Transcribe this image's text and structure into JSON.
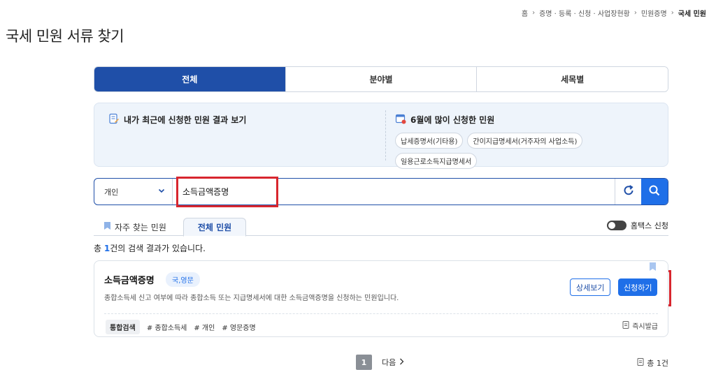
{
  "breadcrumb": {
    "items": [
      "홈",
      "증명 · 등록 · 신청 · 사업장현황",
      "민원증명"
    ],
    "current": "국세 민원",
    "separator": "›"
  },
  "page_title": "국세 민원 서류 찾기",
  "tabs": [
    {
      "label": "전체",
      "active": true
    },
    {
      "label": "분야별",
      "active": false
    },
    {
      "label": "세목별",
      "active": false
    }
  ],
  "info": {
    "recent_label": "내가 최근에 신청한 민원 결과 보기",
    "popular_title": "6월에 많이 신청한 민원",
    "popular_items": [
      "납세증명서(기타용)",
      "간이지급명세서(거주자의 사업소득)",
      "일용근로소득지급명세서"
    ]
  },
  "search": {
    "type_selected": "개인",
    "query": "소득금액증명"
  },
  "subtabs": {
    "favorites_label": "자주 찾는 민원",
    "all_label": "전체 민원",
    "hometax_toggle_label": "홈택스 신청"
  },
  "results": {
    "prefix": "총 ",
    "count": "1",
    "suffix": "건의 검색 결과가 있습니다."
  },
  "card": {
    "title": "소득금액증명",
    "badge": "국,영문",
    "description": "종합소득세 신고 여부에 따라 종합소득 또는 지급명세서에 대한 소득금액증명을 신청하는 민원입니다.",
    "main_tag": "통합검색",
    "tags": [
      "# 종합소득세",
      "# 개인",
      "# 영문증명"
    ],
    "instant_label": "즉시발급",
    "detail_button": "상세보기",
    "apply_button": "신청하기"
  },
  "pagination": {
    "current_page": "1",
    "next_label": "다음"
  },
  "total_bottom": "총 1건",
  "colors": {
    "primary": "#1f4fa8",
    "accent": "#1f6fe8",
    "highlight": "#d8262e",
    "info_bg": "#eef4fb"
  }
}
